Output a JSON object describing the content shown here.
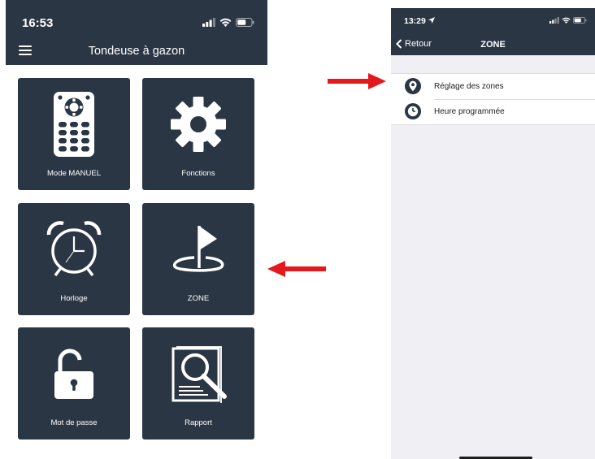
{
  "left_screen": {
    "status_time": "16:53",
    "title": "Tondeuse à gazon",
    "tiles": [
      {
        "label": "Mode MANUEL",
        "icon": "remote-control-icon"
      },
      {
        "label": "Fonctions",
        "icon": "gear-icon"
      },
      {
        "label": "Horloge",
        "icon": "alarm-clock-icon"
      },
      {
        "label": "ZONE",
        "icon": "flag-zone-icon"
      },
      {
        "label": "Mot de passe",
        "icon": "unlocked-padlock-icon"
      },
      {
        "label": "Rapport",
        "icon": "report-search-icon"
      }
    ]
  },
  "right_screen": {
    "status_time": "13:29",
    "back_label": "Retour",
    "title": "ZONE",
    "items": [
      {
        "label": "Réglage des zones",
        "icon": "location-pin-icon"
      },
      {
        "label": "Heure programmée",
        "icon": "clock-icon"
      }
    ]
  },
  "colors": {
    "header_bg": "#2b3644",
    "tile_bg": "#2b3644",
    "arrow": "#e3191b",
    "list_bg": "#ffffff",
    "screen_bg": "#efeff4"
  }
}
